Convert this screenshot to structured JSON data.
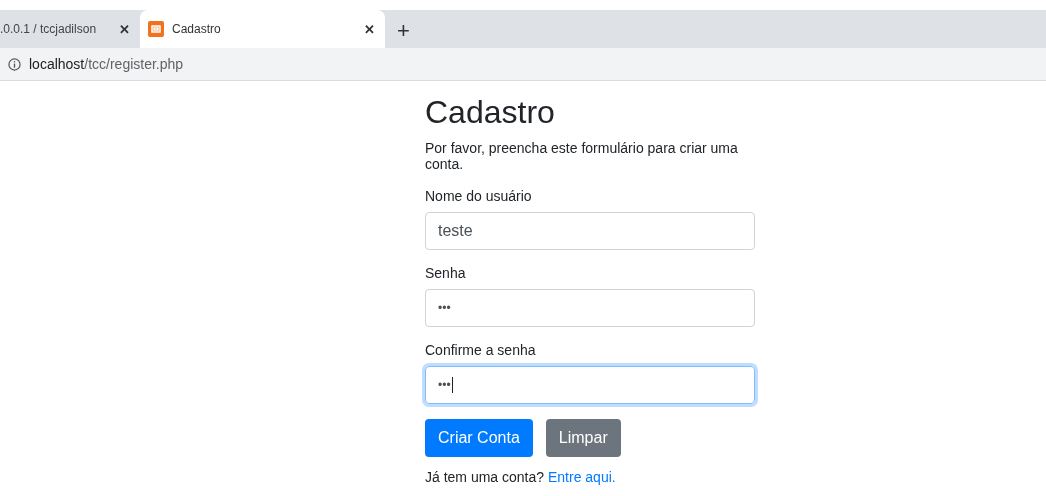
{
  "browser": {
    "tabs": [
      {
        "title": ".0.0.1 / tccjadilson",
        "selected": false,
        "close": "✕"
      },
      {
        "title": "Cadastro",
        "selected": true,
        "close": "✕"
      }
    ],
    "new_tab": "+",
    "url": {
      "host": "localhost",
      "path": "/tcc/register.php"
    }
  },
  "form": {
    "title": "Cadastro",
    "description": "Por favor, preencha este formulário para criar uma conta.",
    "fields": [
      {
        "label": "Nome do usuário",
        "value": "teste",
        "kind": "text",
        "focused": false
      },
      {
        "label": "Senha",
        "value": "•••",
        "kind": "password",
        "focused": false
      },
      {
        "label": "Confirme a senha",
        "value": "•••",
        "kind": "password",
        "focused": true
      }
    ],
    "buttons": [
      {
        "label": "Criar Conta",
        "kind": "primary"
      },
      {
        "label": "Limpar",
        "kind": "secondary"
      }
    ],
    "footer": {
      "text": "Já tem uma conta?",
      "link": "Entre aqui."
    }
  }
}
